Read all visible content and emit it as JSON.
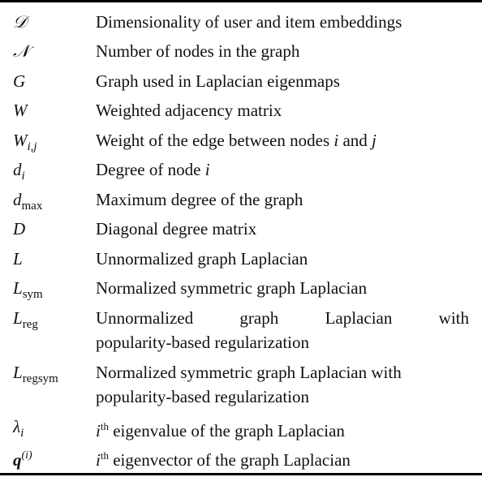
{
  "table": {
    "rows": [
      {
        "symbol": "𝒟",
        "description": "Dimensionality of user and item embeddings"
      },
      {
        "symbol": "𝒩",
        "description": "Number of nodes in the graph"
      },
      {
        "symbol": "G",
        "description": "Graph used in Laplacian eigenmaps"
      },
      {
        "symbol": "W",
        "description": "Weighted adjacency matrix"
      },
      {
        "symbol": "W",
        "symbol_sub": "i,j",
        "description_pre": "Weight of the edge between nodes ",
        "description_i": "i",
        "description_mid": " and ",
        "description_j": "j"
      },
      {
        "symbol": "d",
        "symbol_sub": "i",
        "description_pre": "Degree of node ",
        "description_i": "i"
      },
      {
        "symbol": "d",
        "symbol_sub": "max",
        "description": "Maximum degree of the graph"
      },
      {
        "symbol": "D",
        "description": "Diagonal degree matrix"
      },
      {
        "symbol": "L",
        "description": "Unnormalized graph Laplacian"
      },
      {
        "symbol": "L",
        "symbol_sub": "sym",
        "description": "Normalized symmetric graph Laplacian"
      },
      {
        "symbol": "L",
        "symbol_sub": "reg",
        "description_line1": "Unnormalized graph Laplacian with",
        "description_line2": "popularity-based regularization"
      },
      {
        "symbol": "L",
        "symbol_sub": "regsym",
        "description_line1": "Normalized symmetric graph Laplacian with",
        "description_line2": "popularity-based regularization"
      },
      {
        "symbol": "λ",
        "symbol_sub": "i",
        "description_i": "i",
        "description_sup": "th",
        "description_rest": " eigenvalue of the graph Laplacian"
      },
      {
        "symbol": "q",
        "symbol_sup": "(i)",
        "description_i": "i",
        "description_sup": "th",
        "description_rest": " eigenvector of the graph Laplacian"
      }
    ]
  }
}
